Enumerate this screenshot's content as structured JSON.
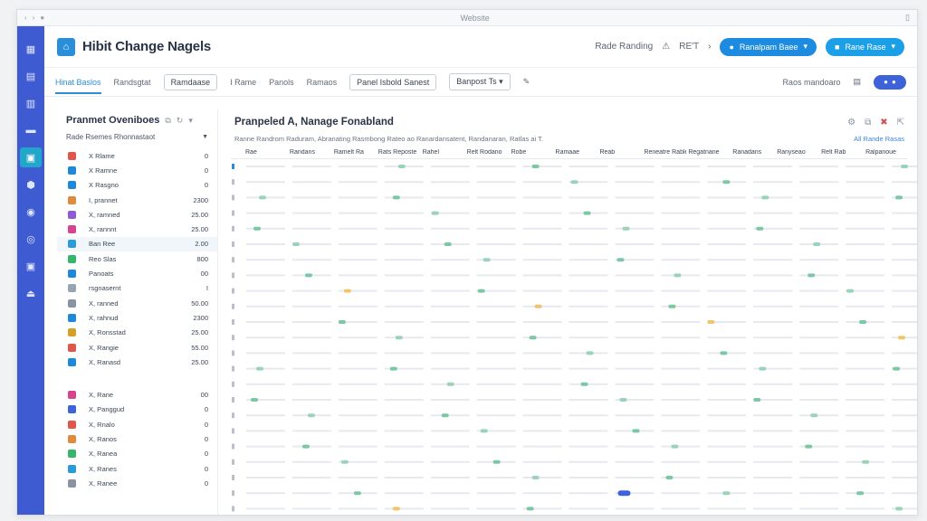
{
  "window": {
    "title": "Website"
  },
  "app": {
    "title": "Hibit Change Nagels"
  },
  "header": {
    "link_text": "Rade Randing",
    "user_text": "RE'T",
    "btn_primary": "Ranalpam Baee",
    "btn_secondary": "Rane Rase"
  },
  "toolbar": {
    "tabs": [
      "Hinat Baslos",
      "Randsgtat",
      "Ramdaase",
      "I Rame",
      "Panols",
      "Ramaos"
    ],
    "chip1": "Panel Isbold Sanest",
    "chip2": "Banpost Ts",
    "right_text": "Raos mandoaro"
  },
  "left_panel": {
    "title": "Pranmet Oveniboes",
    "subtitle": "Rade Rsemes Rhonnastaot",
    "items": [
      {
        "label": "X Rlame",
        "value": "0",
        "color": "#e0564b"
      },
      {
        "label": "X Ramne",
        "value": "0",
        "color": "#1e88d9"
      },
      {
        "label": "X Rasgno",
        "value": "0",
        "color": "#1e88d9"
      },
      {
        "label": "I, prannet",
        "value": "2300",
        "color": "#e08a3b"
      },
      {
        "label": "X, ramned",
        "value": "25.00",
        "color": "#8d5bd6"
      },
      {
        "label": "X, rannnt",
        "value": "25.00",
        "color": "#d7448d"
      },
      {
        "label": "Ban Ree",
        "value": "2.00",
        "color": "#2a9bd8"
      },
      {
        "label": "Reo Slas",
        "value": "800",
        "color": "#37b56b"
      },
      {
        "label": "Panoats",
        "value": "00",
        "color": "#1e88d9"
      },
      {
        "label": "rsgnasernt",
        "value": "I",
        "color": "#9aa3b0"
      },
      {
        "label": "X, ranned",
        "value": "50.00",
        "color": "#8a93a2"
      },
      {
        "label": "X, rahnud",
        "value": "2300",
        "color": "#1e88d9"
      },
      {
        "label": "X, Ronsstad",
        "value": "25.00",
        "color": "#d4a02a"
      },
      {
        "label": "X, Rangie",
        "value": "55.00",
        "color": "#e0564b"
      },
      {
        "label": "X, Ranasd",
        "value": "25.00",
        "color": "#1e88d9"
      }
    ],
    "items2": [
      {
        "label": "X, Rane",
        "value": "00",
        "color": "#d7448d"
      },
      {
        "label": "X, Panggud",
        "value": "0",
        "color": "#3d62d9"
      },
      {
        "label": "X, Rnalo",
        "value": "0",
        "color": "#e0564b"
      },
      {
        "label": "X, Ranos",
        "value": "0",
        "color": "#e08a3b"
      },
      {
        "label": "X, Ranea",
        "value": "0",
        "color": "#37b56b"
      },
      {
        "label": "X, Ranes",
        "value": "0",
        "color": "#2a9bd8"
      },
      {
        "label": "X, Ranee",
        "value": "0",
        "color": "#8a93a2"
      }
    ]
  },
  "main": {
    "title": "Pranpeled A, Nanage Fonabland",
    "subtitle": "Ranne Randrom Raduram, Abranating Rasmbong Rateo ao Ranardansatent, Randanaran, Ratlas ai T.",
    "link": "All Rande Rasas",
    "columns": [
      "Rae",
      "Randans",
      "Ramelt Ra",
      "Rats Reposte",
      "Rahel",
      "Relt Rodano",
      "Robe",
      "Ramaae",
      "Reab",
      "Reneatre Rable",
      "Regatnane",
      "Ranadans",
      "Ranyseao",
      "Relt Rab",
      "Ralpanoue"
    ]
  }
}
